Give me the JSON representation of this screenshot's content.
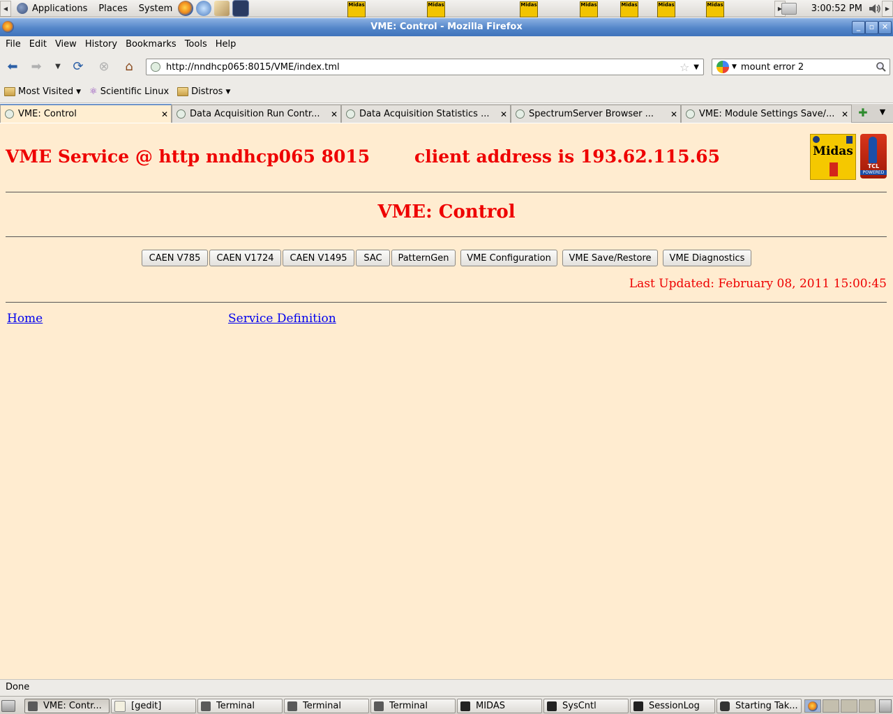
{
  "top_panel": {
    "menus": [
      "Applications",
      "Places",
      "System"
    ],
    "midas_applet_label": "Midas",
    "clock": "3:00:52 PM"
  },
  "window": {
    "title": "VME: Control - Mozilla Firefox"
  },
  "menubar": [
    "File",
    "Edit",
    "View",
    "History",
    "Bookmarks",
    "Tools",
    "Help"
  ],
  "navbar": {
    "url": "http://nndhcp065:8015/VME/index.tml",
    "search": "mount error 2"
  },
  "bookmarks": [
    "Most Visited",
    "Scientific Linux",
    "Distros"
  ],
  "tabs": [
    {
      "label": "VME: Control",
      "active": true
    },
    {
      "label": "Data Acquisition Run Contr...",
      "active": false
    },
    {
      "label": "Data Acquisition Statistics ...",
      "active": false
    },
    {
      "label": "SpectrumServer Browser ...",
      "active": false
    },
    {
      "label": "VME: Module Settings Save/...",
      "active": false
    }
  ],
  "page": {
    "service_heading": "VME Service @ http nndhcp065 8015",
    "client_heading": "client address is 193.62.115.65",
    "title": "VME: Control",
    "buttons": [
      "CAEN V785",
      "CAEN V1724",
      "CAEN V1495",
      "SAC",
      "PatternGen",
      "VME Configuration",
      "VME Save/Restore",
      "VME Diagnostics"
    ],
    "last_updated": "Last Updated: February 08, 2011 15:00:45",
    "links": [
      "Home",
      "Service Definition"
    ],
    "logos": {
      "midas": "Midas",
      "tcl": "TCL",
      "tcl_sub": "POWERED"
    },
    "colors": {
      "background": "#ffecd0",
      "heading": "#ee0000",
      "link": "#0000ee"
    }
  },
  "statusbar": "Done",
  "taskbar": [
    "VME: Contr...",
    "[gedit]",
    "Terminal",
    "Terminal",
    "Terminal",
    "MIDAS",
    "SysCntl",
    "SessionLog",
    "Starting Tak..."
  ]
}
